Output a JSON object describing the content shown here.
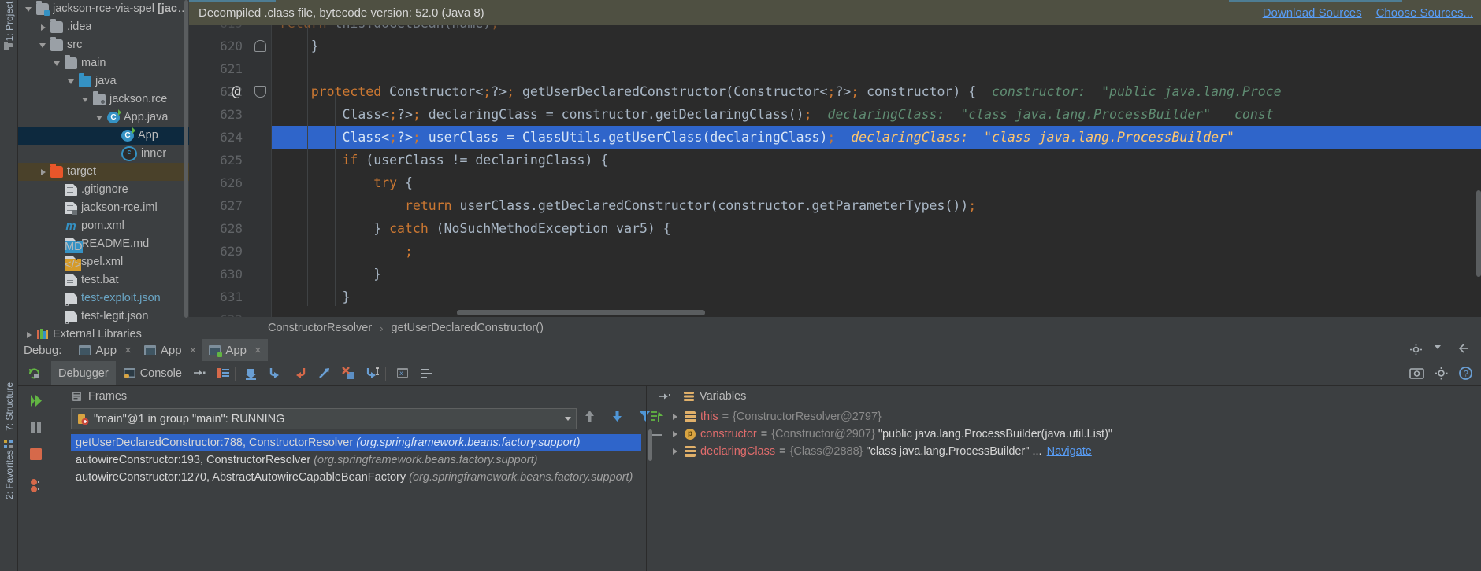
{
  "left_strip": {
    "project_label": "1: Project",
    "structure_label": "7: Structure",
    "favorites_label": "2: Favorites",
    "icons": [
      "project-icon",
      "structure-icon",
      "favorites-icon"
    ]
  },
  "sidebar": {
    "items": [
      {
        "label": "jackson-rce-via-spel",
        "suffix": "[jackson",
        "indent": 0,
        "arrow": "down",
        "icon": "module-folder-icon",
        "state": "normal"
      },
      {
        "label": ".idea",
        "suffix": "",
        "indent": 1,
        "arrow": "right",
        "icon": "folder-icon",
        "state": "normal"
      },
      {
        "label": "src",
        "suffix": "",
        "indent": 1,
        "arrow": "down",
        "icon": "folder-icon",
        "state": "normal"
      },
      {
        "label": "main",
        "suffix": "",
        "indent": 2,
        "arrow": "down",
        "icon": "folder-icon",
        "state": "normal"
      },
      {
        "label": "java",
        "suffix": "",
        "indent": 3,
        "arrow": "down",
        "icon": "source-folder-icon",
        "state": "normal"
      },
      {
        "label": "jackson.rce",
        "suffix": "",
        "indent": 4,
        "arrow": "down",
        "icon": "package-icon",
        "state": "normal"
      },
      {
        "label": "App.java",
        "suffix": "",
        "indent": 5,
        "arrow": "down",
        "icon": "java-class-icon",
        "state": "normal"
      },
      {
        "label": "App",
        "suffix": "",
        "indent": 6,
        "arrow": "none",
        "icon": "java-class-icon",
        "state": "selected"
      },
      {
        "label": "inner",
        "suffix": "",
        "indent": 6,
        "arrow": "none",
        "icon": "inner-class-icon",
        "state": "normal"
      },
      {
        "label": "target",
        "suffix": "",
        "indent": 1,
        "arrow": "right",
        "icon": "excluded-folder-icon",
        "state": "highlighted"
      },
      {
        "label": ".gitignore",
        "suffix": "",
        "indent": 2,
        "arrow": "none",
        "icon": "text-file-icon",
        "state": "normal"
      },
      {
        "label": "jackson-rce.iml",
        "suffix": "",
        "indent": 2,
        "arrow": "none",
        "icon": "iml-file-icon",
        "state": "normal"
      },
      {
        "label": "pom.xml",
        "suffix": "",
        "indent": 2,
        "arrow": "none",
        "icon": "maven-file-icon",
        "state": "normal"
      },
      {
        "label": "README.md",
        "suffix": "",
        "indent": 2,
        "arrow": "none",
        "icon": "markdown-file-icon",
        "state": "normal"
      },
      {
        "label": "spel.xml",
        "suffix": "",
        "indent": 2,
        "arrow": "none",
        "icon": "xml-file-icon",
        "state": "normal"
      },
      {
        "label": "test.bat",
        "suffix": "",
        "indent": 2,
        "arrow": "none",
        "icon": "text-file-icon",
        "state": "normal"
      },
      {
        "label": "test-exploit.json",
        "suffix": "",
        "indent": 2,
        "arrow": "none",
        "icon": "json-file-icon",
        "state": "link"
      },
      {
        "label": "test-legit.json",
        "suffix": "",
        "indent": 2,
        "arrow": "none",
        "icon": "json-file-icon",
        "state": "normal"
      },
      {
        "label": "External Libraries",
        "suffix": "",
        "indent": 0,
        "arrow": "right",
        "icon": "libraries-icon",
        "state": "normal"
      }
    ]
  },
  "editor": {
    "notice": {
      "text": "Decompiled .class file, bytecode version: 52.0 (Java 8)",
      "download_sources": "Download Sources",
      "choose_sources": "Choose Sources..."
    },
    "lines": [
      {
        "number": "619",
        "code": "return this.doGetBean(name);",
        "clipped": true
      },
      {
        "number": "620",
        "code": "    }",
        "fold": "close"
      },
      {
        "number": "621",
        "code": ""
      },
      {
        "number": "622",
        "code": "    protected Constructor<?> getUserDeclaredConstructor(Constructor<?> constructor) {",
        "hint": "constructor:  \"public java.lang.Proce",
        "annotation": "@",
        "fold": "open"
      },
      {
        "number": "623",
        "code": "        Class<?> declaringClass = constructor.getDeclaringClass();",
        "hint": "declaringClass:  \"class java.lang.ProcessBuilder\"   const"
      },
      {
        "number": "624",
        "code": "        Class<?> userClass = ClassUtils.getUserClass(declaringClass);",
        "hint": "declaringClass:  \"class java.lang.ProcessBuilder\"",
        "highlighted": true
      },
      {
        "number": "625",
        "code": "        if (userClass != declaringClass) {"
      },
      {
        "number": "626",
        "code": "            try {"
      },
      {
        "number": "627",
        "code": "                return userClass.getDeclaredConstructor(constructor.getParameterTypes());"
      },
      {
        "number": "628",
        "code": "            } catch (NoSuchMethodException var5) {"
      },
      {
        "number": "629",
        "code": "                ;"
      },
      {
        "number": "630",
        "code": "            }"
      },
      {
        "number": "631",
        "code": "        }"
      },
      {
        "number": "632",
        "code": "",
        "clipped": true
      }
    ],
    "breadcrumb": [
      "ConstructorResolver",
      "getUserDeclaredConstructor()"
    ]
  },
  "debug": {
    "title": "Debug:",
    "tabs": [
      {
        "label": "App",
        "active": false,
        "running": false
      },
      {
        "label": "App",
        "active": false,
        "running": false
      },
      {
        "label": "App",
        "active": true,
        "running": true
      }
    ],
    "close_glyph": "×",
    "sub_tabs": [
      {
        "label": "Debugger",
        "active": true,
        "icon": ""
      },
      {
        "label": "Console",
        "active": false,
        "icon": "console-icon"
      }
    ],
    "toolbar_icons": [
      "rerun-icon",
      "pause-icon",
      "stop-icon",
      "view-breakpoints-icon",
      "mute-breakpoints-icon",
      "step-over-icon",
      "step-into-icon",
      "force-step-into-icon",
      "step-out-icon",
      "drop-frame-icon",
      "run-to-cursor-icon",
      "evaluate-expression-icon",
      "layout-settings-icon",
      "settings-gear-icon",
      "help-icon",
      "restore-layout-icon"
    ],
    "frames": {
      "title": "Frames",
      "thread_selector": "\"main\"@1 in group \"main\": RUNNING",
      "rows": [
        {
          "method": "getUserDeclaredConstructor:788, ConstructorResolver",
          "package": "(org.springframework.beans.factory.support)",
          "selected": true
        },
        {
          "method": "autowireConstructor:193, ConstructorResolver",
          "package": "(org.springframework.beans.factory.support)",
          "selected": false
        },
        {
          "method": "autowireConstructor:1270, AbstractAutowireCapableBeanFactory",
          "package": "(org.springframework.beans.factory.support)",
          "selected": false
        }
      ]
    },
    "variables": {
      "title": "Variables",
      "rows": [
        {
          "name": "this",
          "id": "{ConstructorResolver@2797}",
          "value": "",
          "icon": "object-icon",
          "navigate": ""
        },
        {
          "name": "constructor",
          "id": "{Constructor@2907}",
          "value": "\"public java.lang.ProcessBuilder(java.util.List)\"",
          "icon": "parameter-icon",
          "navigate": ""
        },
        {
          "name": "declaringClass",
          "id": "{Class@2888}",
          "value": "\"class java.lang.ProcessBuilder\" ...",
          "icon": "object-icon",
          "navigate": "Navigate"
        }
      ]
    }
  },
  "colors": {
    "editor_bg": "#2b2b2b",
    "panel_bg": "#3c3f41",
    "selection_blue": "#2f65ca",
    "tree_selection": "#0d293e",
    "notice_bg": "#4f5042",
    "link_blue": "#589df6",
    "keyword_orange": "#cc7832",
    "hint_green": "#5f8c72",
    "hint_yellow": "#ffc66d",
    "var_red": "#e06c6c"
  }
}
